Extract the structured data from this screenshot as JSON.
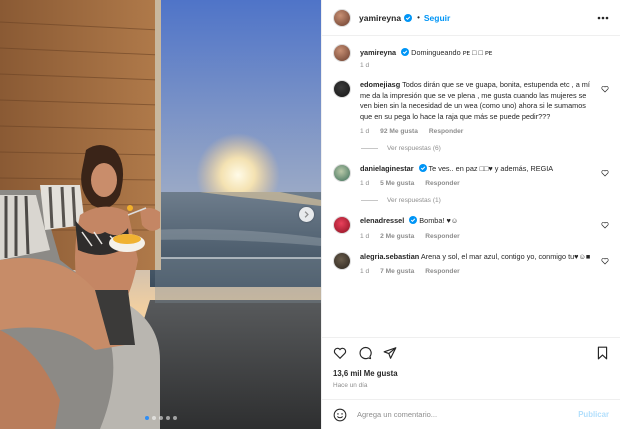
{
  "post": {
    "author": "yamireyna",
    "follow_label": "Seguir",
    "separator": "•",
    "caption_text": "Domingueando ᴘᴇ □ □ ᴘᴇ",
    "caption_age": "1 d"
  },
  "comments": [
    {
      "user": "edomejiasg",
      "text": "Todos dirán que se ve guapa, bonita, estupenda etc , a mí me da la impresión que se ve plena , me gusta cuando las mujeres se ven bien sin la necesidad de un wea (como uno) ahora si le sumamos que en su pega lo hace la raja que más se puede pedir???",
      "age": "1 d",
      "likes": "92 Me gusta",
      "reply": "Responder",
      "view_replies": "Ver respuestas (6)"
    },
    {
      "user": "danielaginestar",
      "verified": true,
      "text": "Te ves.. en paz □□♥ y además, REGIA",
      "age": "1 d",
      "likes": "5 Me gusta",
      "reply": "Responder",
      "view_replies": "Ver respuestas (1)"
    },
    {
      "user": "elenadressel",
      "verified": true,
      "text": "Bomba! ♥☺",
      "age": "1 d",
      "likes": "2 Me gusta",
      "reply": "Responder"
    },
    {
      "user": "alegria.sebastian",
      "text": "Arena y sol, el mar azul, contigo yo, conmigo tu♥☺■",
      "age": "1 d",
      "likes": "7 Me gusta",
      "reply": "Responder"
    }
  ],
  "footer": {
    "likes": "13,6 mil Me gusta",
    "posted": "Hace un día",
    "comment_placeholder": "Agrega un comentario...",
    "publish_label": "Publicar"
  },
  "colors": {
    "accent": "#0095f6",
    "publish_disabled": "#b2dffc",
    "muted": "#8e8e8e",
    "text": "#262626"
  },
  "icons": [
    "like-icon",
    "comment-icon",
    "share-icon",
    "save-icon",
    "more-options-icon",
    "verified-icon",
    "emoji-icon",
    "next-photo-icon"
  ]
}
